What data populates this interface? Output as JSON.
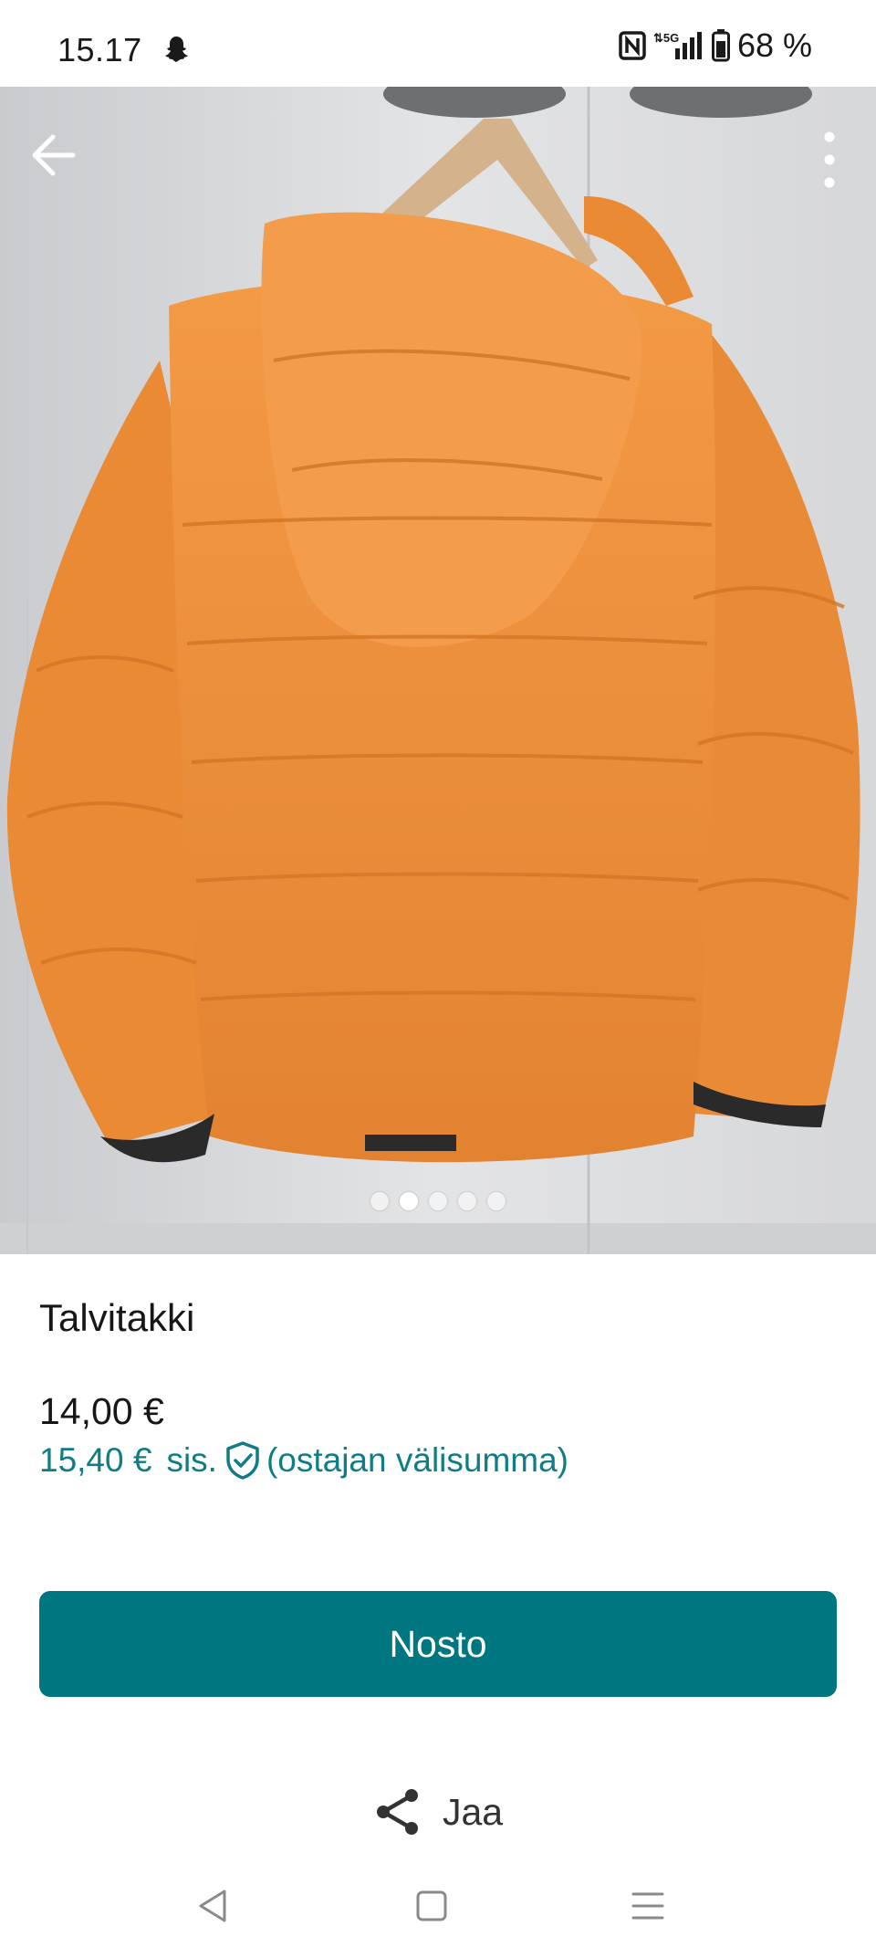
{
  "status_bar": {
    "time": "15.17",
    "battery": "68 %",
    "network": "5G"
  },
  "gallery": {
    "image_count": 5,
    "active_index": 1
  },
  "item": {
    "title": "Talvitakki",
    "price": "14,00 €",
    "buyer_price": "15,40 €",
    "buyer_includes": "sis.",
    "buyer_note": "(ostajan välisumma)"
  },
  "actions": {
    "primary_label": "Nosto",
    "share_label": "Jaa"
  },
  "colors": {
    "accent": "#007780",
    "buyer_price_text": "#0f7c86",
    "jacket": "#ee8d39"
  },
  "icons": [
    "snapchat-ghost-icon",
    "nfc-icon",
    "signal-icon",
    "battery-icon",
    "back-arrow-icon",
    "more-vertical-icon",
    "buyer-protection-shield-icon",
    "share-icon",
    "nav-back-icon",
    "nav-home-icon",
    "nav-recents-icon"
  ]
}
